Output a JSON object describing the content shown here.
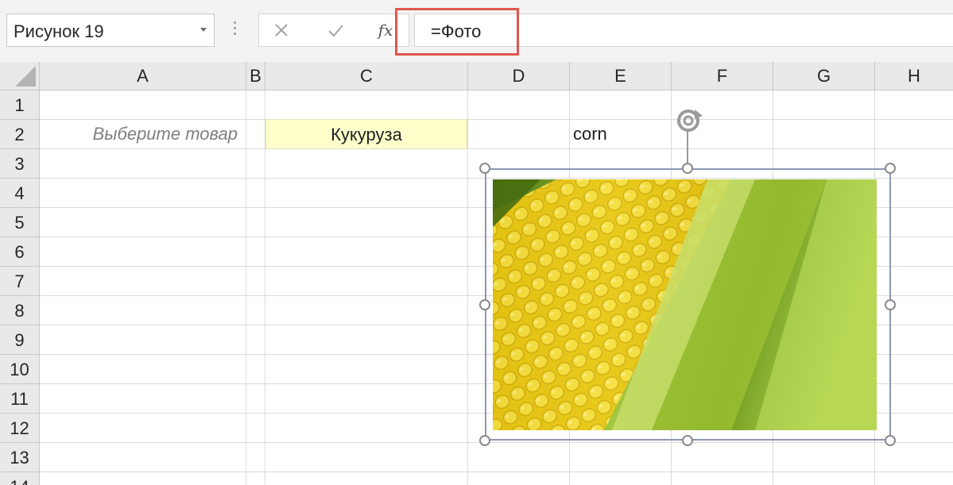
{
  "formula_bar": {
    "name_box": "Рисунок 19",
    "cancel_icon": "close-icon",
    "enter_icon": "check-icon",
    "fx_label": "fx",
    "formula": "=Фото",
    "highlight_color": "#e0574f"
  },
  "columns": [
    "A",
    "B",
    "C",
    "D",
    "E",
    "F",
    "G",
    "H"
  ],
  "rows": [
    "1",
    "2",
    "3",
    "4",
    "5",
    "6",
    "7",
    "8",
    "9",
    "10",
    "11",
    "12",
    "13",
    "14"
  ],
  "cells": {
    "A2": "Выберите товар",
    "C2": "Кукуруза",
    "E2": "corn"
  },
  "cell_colors": {
    "C2_fill": "#ffffcc"
  },
  "picture": {
    "subject": "corn cob photo"
  }
}
